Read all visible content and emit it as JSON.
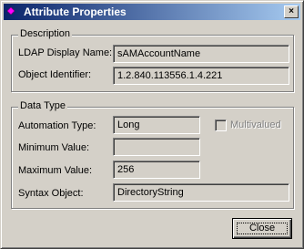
{
  "window": {
    "title": "Attribute Properties",
    "close_glyph": "×"
  },
  "description": {
    "group_title": "Description",
    "ldap_label": "LDAP Display Name:",
    "ldap_value": "sAMAccountName",
    "oid_label": "Object Identifier:",
    "oid_value": "1.2.840.113556.1.4.221"
  },
  "data_type": {
    "group_title": "Data Type",
    "automation_label": "Automation Type:",
    "automation_value": "Long",
    "multivalued_label": "Multivalued",
    "multivalued_checked": false,
    "min_label": "Minimum Value:",
    "min_value": "",
    "max_label": "Maximum Value:",
    "max_value": "256",
    "syntax_label": "Syntax Object:",
    "syntax_value": "DirectoryString"
  },
  "buttons": {
    "close_label": "Close"
  },
  "icons": {
    "title_icon": "diamond-icon"
  },
  "colors": {
    "title_gradient_start": "#0a246a",
    "title_gradient_end": "#a6caf0",
    "face": "#d4d0c8"
  }
}
